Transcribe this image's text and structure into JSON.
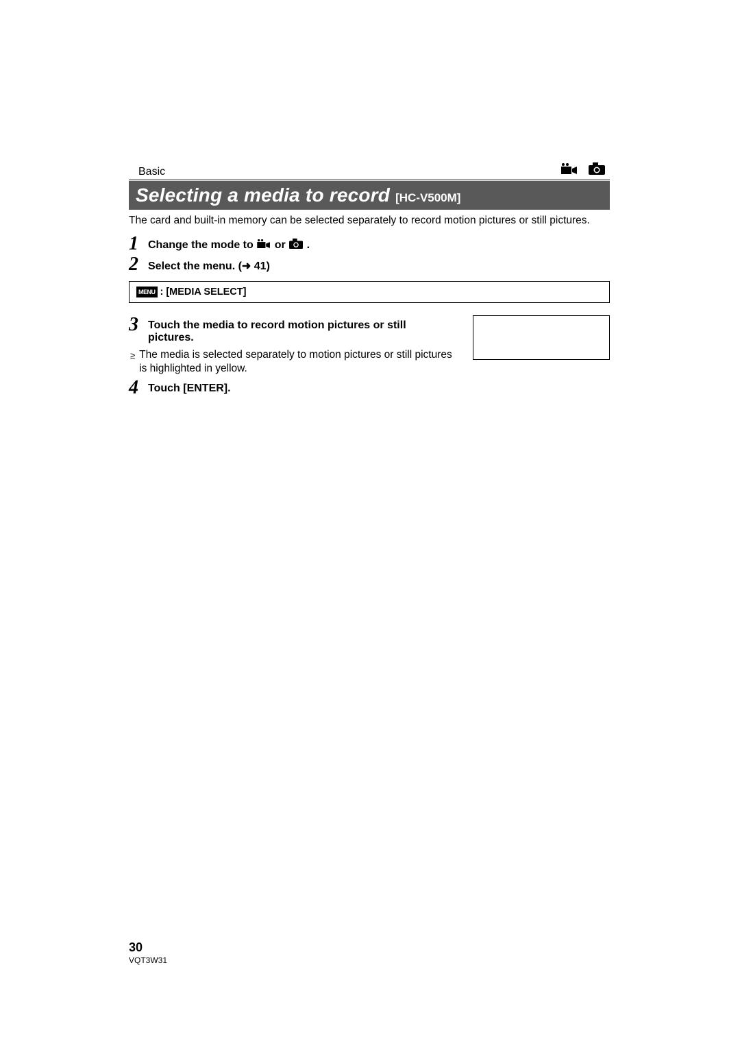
{
  "header": {
    "section": "Basic"
  },
  "title": {
    "main": "Selecting a media to record ",
    "sub": "[HC-V500M]"
  },
  "intro": "The card and built-in memory can be selected separately to record motion pictures or still pictures.",
  "steps": {
    "s1": {
      "num": "1",
      "pre": "Change the mode to ",
      "mid": " or ",
      "post": " ."
    },
    "s2": {
      "num": "2",
      "text": "Select the menu. (",
      "ref": " 41)"
    },
    "s3": {
      "num": "3",
      "text": "Touch the media to record motion pictures or still pictures."
    },
    "s4": {
      "num": "4",
      "text": "Touch [ENTER]."
    }
  },
  "menuBox": {
    "badge": "MENU",
    "text": ": [MEDIA SELECT]"
  },
  "bullet": "The media is selected separately to motion pictures or still pictures is highlighted in yellow.",
  "footer": {
    "page": "30",
    "code": "VQT3W31"
  }
}
